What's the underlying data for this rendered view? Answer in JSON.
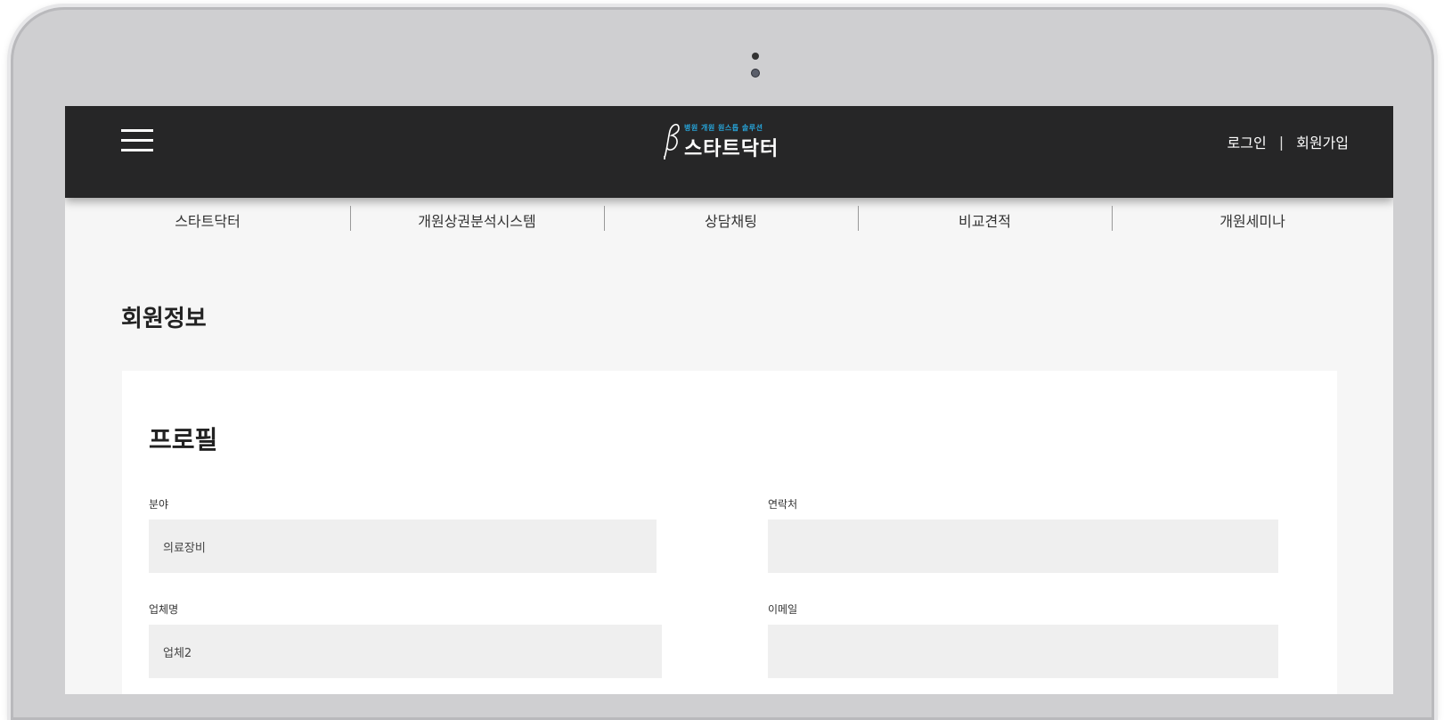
{
  "header": {
    "logo_tagline": "병원 개원 원스톱 솔루션",
    "logo_name": "스타트닥터",
    "login_label": "로그인",
    "separator": "|",
    "signup_label": "회원가입"
  },
  "nav": {
    "items": [
      {
        "label": "스타트닥터"
      },
      {
        "label": "개원상권분석시스템"
      },
      {
        "label": "상담채팅"
      },
      {
        "label": "비교견적"
      },
      {
        "label": "개원세미나"
      }
    ]
  },
  "page": {
    "title": "회원정보"
  },
  "profile": {
    "title": "프로필",
    "fields": {
      "field_label": "분야",
      "field_value": "의료장비",
      "contact_label": "연락처",
      "contact_value": "",
      "company_label": "업체명",
      "company_value": "업체2",
      "email_label": "이메일",
      "email_value": ""
    }
  },
  "colors": {
    "topbar": "#262627",
    "accent": "#27a4d9",
    "input_bg": "#efefef"
  }
}
